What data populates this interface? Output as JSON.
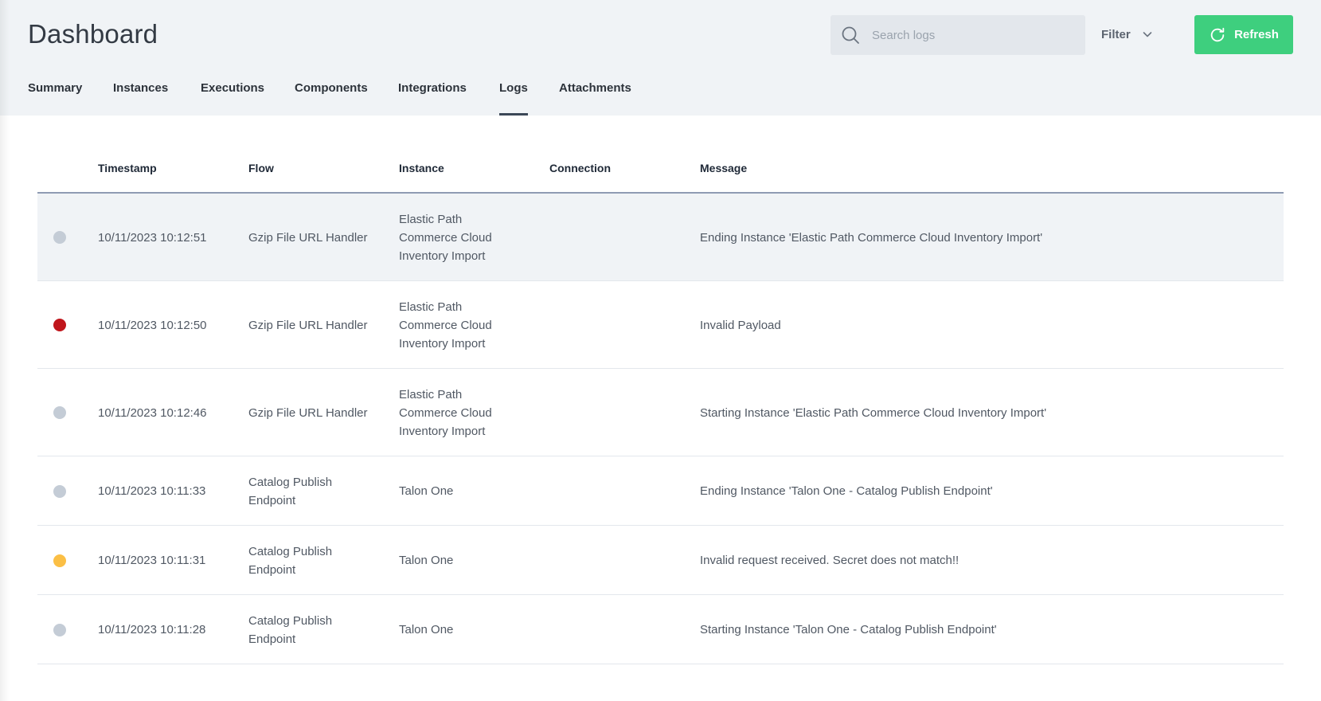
{
  "header": {
    "title": "Dashboard",
    "search_placeholder": "Search logs",
    "filter_label": "Filter",
    "refresh_label": "Refresh"
  },
  "tabs": [
    {
      "label": "Summary",
      "active": false
    },
    {
      "label": "Instances",
      "active": false
    },
    {
      "label": "Executions",
      "active": false
    },
    {
      "label": "Components",
      "active": false
    },
    {
      "label": "Integrations",
      "active": false
    },
    {
      "label": "Logs",
      "active": true
    },
    {
      "label": "Attachments",
      "active": false
    }
  ],
  "table": {
    "columns": [
      "Timestamp",
      "Flow",
      "Instance",
      "Connection",
      "Message"
    ],
    "rows": [
      {
        "level": "info",
        "timestamp": "10/11/2023 10:12:51",
        "flow": [
          "Gzip File URL Handler"
        ],
        "instance": [
          "Elastic Path",
          "Commerce Cloud",
          "Inventory Import"
        ],
        "connection": "",
        "message": "Ending Instance 'Elastic Path Commerce Cloud Inventory Import'"
      },
      {
        "level": "error",
        "timestamp": "10/11/2023 10:12:50",
        "flow": [
          "Gzip File URL Handler"
        ],
        "instance": [
          "Elastic Path",
          "Commerce Cloud",
          "Inventory Import"
        ],
        "connection": "",
        "message": "Invalid Payload"
      },
      {
        "level": "info",
        "timestamp": "10/11/2023 10:12:46",
        "flow": [
          "Gzip File URL Handler"
        ],
        "instance": [
          "Elastic Path",
          "Commerce Cloud",
          "Inventory Import"
        ],
        "connection": "",
        "message": "Starting Instance 'Elastic Path Commerce Cloud Inventory Import'"
      },
      {
        "level": "info",
        "timestamp": "10/11/2023 10:11:33",
        "flow": [
          "Catalog Publish",
          "Endpoint"
        ],
        "instance": [
          "Talon One"
        ],
        "connection": "",
        "message": "Ending Instance 'Talon One - Catalog Publish Endpoint'"
      },
      {
        "level": "warn",
        "timestamp": "10/11/2023 10:11:31",
        "flow": [
          "Catalog Publish",
          "Endpoint"
        ],
        "instance": [
          "Talon One"
        ],
        "connection": "",
        "message": "Invalid request received. Secret does not match!!"
      },
      {
        "level": "info",
        "timestamp": "10/11/2023 10:11:28",
        "flow": [
          "Catalog Publish",
          "Endpoint"
        ],
        "instance": [
          "Talon One"
        ],
        "connection": "",
        "message": "Starting Instance 'Talon One - Catalog Publish Endpoint'"
      }
    ]
  },
  "colors": {
    "accent_green": "#3ecf7e",
    "info": "#c4ccd6",
    "error": "#c0161c",
    "warn": "#fbbf45"
  },
  "icons": {
    "search": "search-icon",
    "filter": "chevron-down-icon",
    "refresh": "refresh-icon"
  }
}
